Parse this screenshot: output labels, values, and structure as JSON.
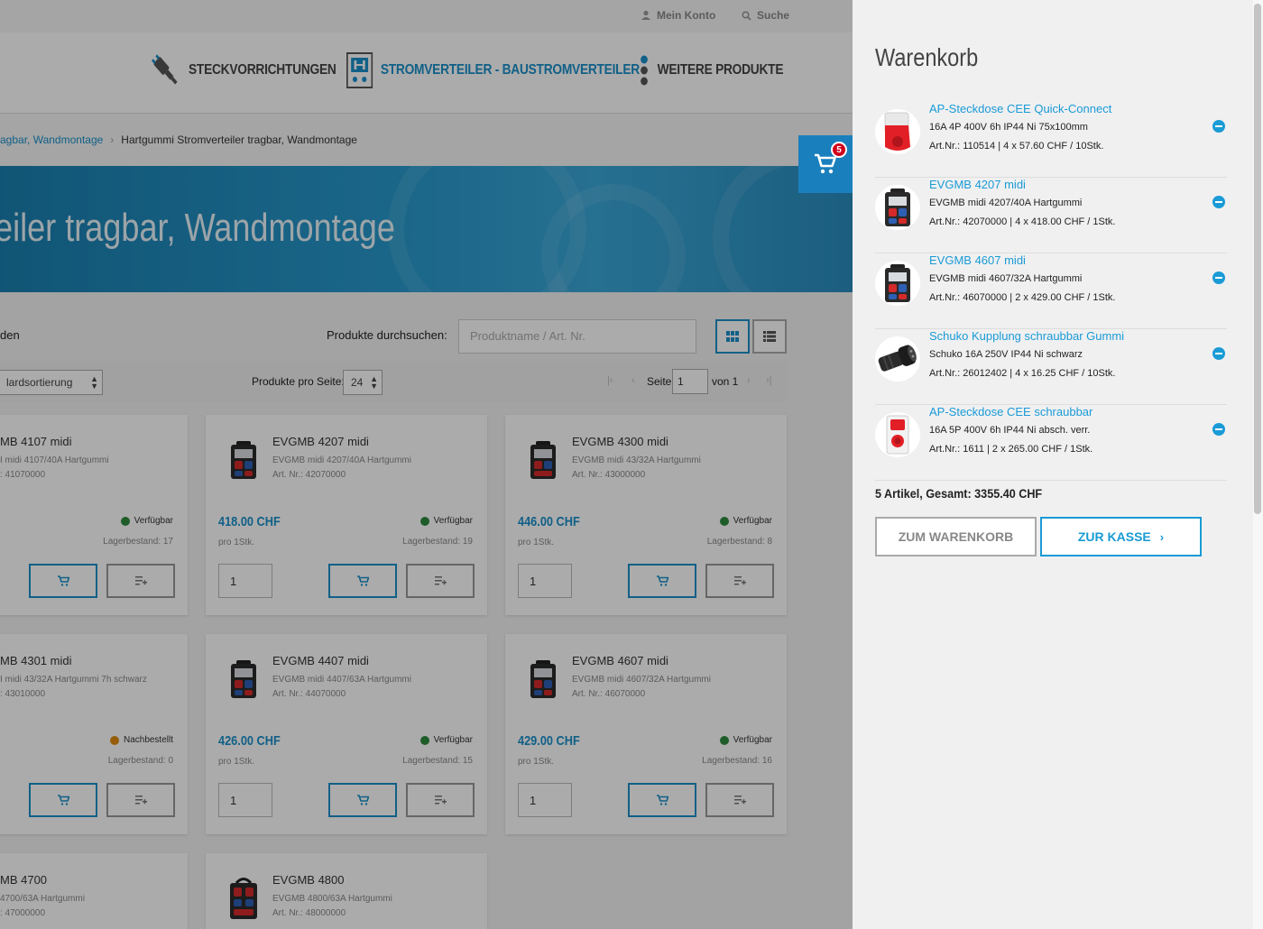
{
  "topbar": {
    "account_label": "Mein Konto",
    "search_label": "Suche"
  },
  "nav": {
    "items": [
      {
        "label": "Steckvorrichtungen",
        "icon": "plug-icon"
      },
      {
        "label": "Stromverteiler - Baustromverteiler",
        "icon": "distributor-icon",
        "active": true
      },
      {
        "label": "Weitere Produkte",
        "icon": "more-dots-icon"
      }
    ]
  },
  "breadcrumb": {
    "parent": "ragbar, Wandmontage",
    "current": "Hartgummi Stromverteiler tragbar, Wandmontage"
  },
  "hero": {
    "title": "eiler tragbar, Wandmontage"
  },
  "listbar": {
    "left_label": "den",
    "search_label": "Produkte durchsuchen:",
    "search_placeholder": "Produktname / Art. Nr."
  },
  "filter": {
    "sort_value": "lardsortierung",
    "per_page_label": "Produkte pro Seite:",
    "per_page_value": "24",
    "page_label": "Seite",
    "page_value": "1",
    "page_of": "von 1"
  },
  "products": [
    {
      "name": "MB 4107 midi",
      "desc": "I midi 4107/40A Hartgummi",
      "art": ": 41070000",
      "price": "",
      "unit": "",
      "availability": "Verfügbar",
      "status": "green",
      "stock": "Lagerbestand: 17"
    },
    {
      "name": "EVGMB 4207 midi",
      "desc": "EVGMB midi 4207/40A Hartgummi",
      "art": "Art. Nr.: 42070000",
      "price": "418.00 CHF",
      "unit": "pro 1Stk.",
      "availability": "Verfügbar",
      "status": "green",
      "stock": "Lagerbestand: 19",
      "qty": "1"
    },
    {
      "name": "EVGMB 4300 midi",
      "desc": "EVGMB midi 43/32A Hartgummi",
      "art": "Art. Nr.: 43000000",
      "price": "446.00 CHF",
      "unit": "pro 1Stk.",
      "availability": "Verfügbar",
      "status": "green",
      "stock": "Lagerbestand: 8",
      "qty": "1"
    },
    {
      "name": "MB 4301 midi",
      "desc": "I midi 43/32A Hartgummi 7h schwarz",
      "art": ": 43010000",
      "price": "",
      "unit": "",
      "availability": "Nachbestellt",
      "status": "orange",
      "stock": "Lagerbestand: 0"
    },
    {
      "name": "EVGMB 4407 midi",
      "desc": "EVGMB midi 4407/63A Hartgummi",
      "art": "Art. Nr.: 44070000",
      "price": "426.00 CHF",
      "unit": "pro 1Stk.",
      "availability": "Verfügbar",
      "status": "green",
      "stock": "Lagerbestand: 15",
      "qty": "1"
    },
    {
      "name": "EVGMB 4607 midi",
      "desc": "EVGMB midi 4607/32A Hartgummi",
      "art": "Art. Nr.: 46070000",
      "price": "429.00 CHF",
      "unit": "pro 1Stk.",
      "availability": "Verfügbar",
      "status": "green",
      "stock": "Lagerbestand: 16",
      "qty": "1"
    },
    {
      "name": "MB 4700",
      "desc": "4700/63A Hartgummi",
      "art": ": 47000000"
    },
    {
      "name": "EVGMB 4800",
      "desc": "EVGMB 4800/63A Hartgummi",
      "art": "Art. Nr.: 48000000"
    }
  ],
  "cart_fab": {
    "count": "5"
  },
  "sidecart": {
    "title": "Warenkorb",
    "items": [
      {
        "name": "AP-Steckdose CEE Quick-Connect",
        "desc": "16A 4P 400V 6h IP44 Ni 75x100mm",
        "art": "Art.Nr.: 110514 | 4 x 57.60 CHF / 10Stk.",
        "img": "red-socket"
      },
      {
        "name": "EVGMB 4207 midi",
        "desc": "EVGMB midi 4207/40A Hartgummi",
        "art": "Art.Nr.: 42070000 | 4 x 418.00 CHF / 1Stk.",
        "img": "distributor"
      },
      {
        "name": "EVGMB 4607 midi",
        "desc": "EVGMB midi 4607/32A Hartgummi",
        "art": "Art.Nr.: 46070000 | 2 x 429.00 CHF / 1Stk.",
        "img": "distributor"
      },
      {
        "name": "Schuko Kupplung schraubbar Gummi",
        "desc": "Schuko 16A 250V IP44 Ni schwarz",
        "art": "Art.Nr.: 26012402 | 4 x 16.25 CHF / 10Stk.",
        "img": "black-coupling"
      },
      {
        "name": "AP-Steckdose CEE schraubbar",
        "desc": "16A 5P 400V 6h IP44 Ni absch. verr.",
        "art": "Art.Nr.: 1611 | 2 x 265.00 CHF / 1Stk.",
        "img": "white-socket"
      }
    ],
    "total": "5 Artikel, Gesamt: 3355.40 CHF",
    "btn_cart": "Zum Warenkorb",
    "btn_checkout": "Zur Kasse"
  },
  "colors": {
    "accent": "#1a9bd6",
    "nav_active": "#1a8fc9",
    "badge": "#d0021b",
    "available": "#2e8b3e",
    "reorder": "#e08a0b"
  }
}
